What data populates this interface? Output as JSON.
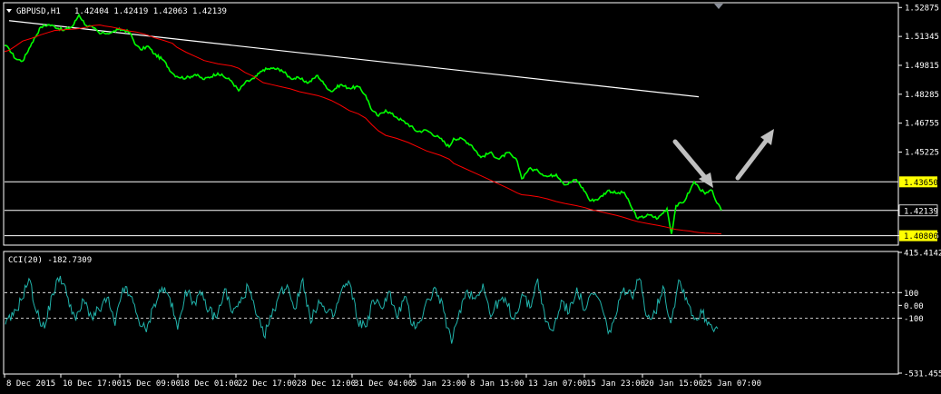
{
  "main_panel": {
    "symbol": "GBPUSD,H1",
    "ohlc": "1.42404 1.42419 1.42063 1.42139",
    "price_ticks": [
      "1.52875",
      "1.51345",
      "1.49815",
      "1.48285",
      "1.46755",
      "1.45225",
      "1.40805"
    ],
    "hline_labels": [
      "1.43650",
      "1.42139",
      "1.40800"
    ]
  },
  "indicator_panel": {
    "title": "CCI(20) -182.7309",
    "ticks": [
      "415.4142",
      "100",
      "0.00",
      "-100",
      "-531.4553"
    ]
  },
  "time_labels": [
    "8 Dec 2015",
    "10 Dec 17:00",
    "15 Dec 09:00",
    "18 Dec 01:00",
    "22 Dec 17:00",
    "28 Dec 12:00",
    "31 Dec 04:00",
    "5 Jan 23:00",
    "8 Jan 15:00",
    "13 Jan 07:00",
    "15 Jan 23:00",
    "20 Jan 15:00",
    "25 Jan 07:00"
  ],
  "colors": {
    "background": "#000000",
    "grid": "#ffffff",
    "price": "#00ff00",
    "ma": "#ff0000",
    "trendline": "#ffffff",
    "level_fill": "#ffff00",
    "cci": "#20b2aa",
    "arrow": "#c0c0c0"
  },
  "chart_data": [
    {
      "type": "line",
      "title": "GBPUSD,H1",
      "ylim": [
        1.4035,
        1.5308
      ],
      "x": [
        0,
        5,
        12,
        20,
        30,
        40,
        48,
        55,
        65,
        75,
        82,
        90,
        98,
        105,
        110,
        118,
        125,
        132,
        138,
        145,
        150,
        158,
        165,
        175,
        185,
        190,
        200,
        210,
        220,
        235,
        250,
        258,
        265,
        275,
        285,
        295,
        305,
        315,
        325,
        335,
        345,
        352,
        360,
        370,
        380,
        390,
        398,
        405,
        412,
        420,
        432,
        445,
        455,
        465,
        480,
        490,
        495,
        505,
        515,
        525,
        535,
        545,
        555,
        565,
        570,
        578,
        588,
        598,
        608,
        618,
        630,
        640,
        645,
        655,
        665,
        675,
        683,
        690,
        698,
        710,
        720,
        730,
        735,
        740,
        748,
        756,
        760,
        765,
        772,
        780,
        785,
        790
      ],
      "series": [
        {
          "name": "Price",
          "values": [
            1.5086,
            1.5069,
            1.5017,
            1.5004,
            1.5099,
            1.5184,
            1.5197,
            1.5188,
            1.5166,
            1.5188,
            1.5249,
            1.5192,
            1.5179,
            1.5149,
            1.5151,
            1.5155,
            1.517,
            1.5168,
            1.5154,
            1.5088,
            1.5064,
            1.5083,
            1.5042,
            1.5009,
            1.494,
            1.4923,
            1.4914,
            1.4933,
            1.4907,
            1.494,
            1.4899,
            1.4847,
            1.4889,
            1.4912,
            1.4958,
            1.4965,
            1.4958,
            1.4914,
            1.4912,
            1.4889,
            1.4928,
            1.4883,
            1.4843,
            1.4879,
            1.4861,
            1.4868,
            1.4823,
            1.4743,
            1.4713,
            1.4745,
            1.4707,
            1.4669,
            1.4631,
            1.4638,
            1.4595,
            1.455,
            1.4595,
            1.4591,
            1.4557,
            1.4494,
            1.452,
            1.4485,
            1.452,
            1.4474,
            1.4382,
            1.4435,
            1.4422,
            1.4393,
            1.4405,
            1.4349,
            1.4377,
            1.4312,
            1.4265,
            1.4276,
            1.432,
            1.4304,
            1.4309,
            1.4239,
            1.417,
            1.419,
            1.4172,
            1.4224,
            1.409,
            1.4239,
            1.4255,
            1.4326,
            1.4365,
            1.4336,
            1.4301,
            1.4318,
            1.4253,
            1.4214
          ]
        },
        {
          "name": "MA",
          "values": [
            1.5054,
            1.5061,
            1.5083,
            1.511,
            1.5125,
            1.5143,
            1.5155,
            1.5166,
            1.517,
            1.5173,
            1.5176,
            1.5183,
            1.5192,
            1.5195,
            1.519,
            1.5184,
            1.5177,
            1.517,
            1.5163,
            1.5158,
            1.5152,
            1.5141,
            1.5128,
            1.5114,
            1.5098,
            1.5077,
            1.5051,
            1.5029,
            1.5007,
            1.499,
            1.4979,
            1.4966,
            1.4944,
            1.4922,
            1.489,
            1.4879,
            1.4868,
            1.4857,
            1.4842,
            1.4832,
            1.4822,
            1.4811,
            1.4796,
            1.4771,
            1.4742,
            1.4725,
            1.4702,
            1.4666,
            1.4635,
            1.4611,
            1.4595,
            1.4573,
            1.4551,
            1.4529,
            1.4506,
            1.4485,
            1.4463,
            1.4441,
            1.4419,
            1.4397,
            1.4375,
            1.4353,
            1.4331,
            1.4306,
            1.4297,
            1.4293,
            1.4286,
            1.4275,
            1.4261,
            1.425,
            1.4239,
            1.4228,
            1.422,
            1.4209,
            1.4198,
            1.4187,
            1.4176,
            1.4165,
            1.4154,
            1.4143,
            1.4135,
            1.4125,
            1.4118,
            1.4113,
            1.4108,
            1.4104,
            1.41,
            1.4097,
            1.4094,
            1.4092,
            1.4091,
            1.409
          ]
        }
      ],
      "trendline": {
        "x": [
          5,
          765
        ],
        "y": [
          1.5218,
          1.4815
        ]
      },
      "hlines": [
        1.4365,
        1.42139,
        1.408
      ]
    },
    {
      "type": "line",
      "title": "CCI(20) -182.7309",
      "ylim": [
        -531.4553,
        415.4142
      ],
      "levels": [
        100,
        -100
      ],
      "series": [
        {
          "name": "CCI(20)",
          "values": [
            -150,
            -80,
            40,
            210,
            -60,
            -180,
            90,
            230,
            60,
            -120,
            40,
            -90,
            -40,
            60,
            -160,
            140,
            70,
            -110,
            -210,
            10,
            140,
            60,
            -190,
            120,
            30,
            80,
            -40,
            -100,
            130,
            -60,
            20,
            150,
            -70,
            -240,
            -90,
            90,
            160,
            -30,
            210,
            -140,
            40,
            -60,
            -80,
            130,
            170,
            -120,
            -170,
            40,
            -20,
            110,
            -100,
            70,
            -160,
            -120,
            50,
            130,
            -50,
            -300,
            -40,
            120,
            50,
            170,
            -90,
            40,
            20,
            -110,
            90,
            -20,
            210,
            -130,
            -200,
            40,
            -60,
            140,
            -40,
            90,
            30,
            -220,
            -80,
            140,
            70,
            210,
            -90,
            -60,
            150,
            -140,
            200,
            60,
            -110,
            -60,
            -150,
            -183
          ]
        }
      ]
    }
  ]
}
